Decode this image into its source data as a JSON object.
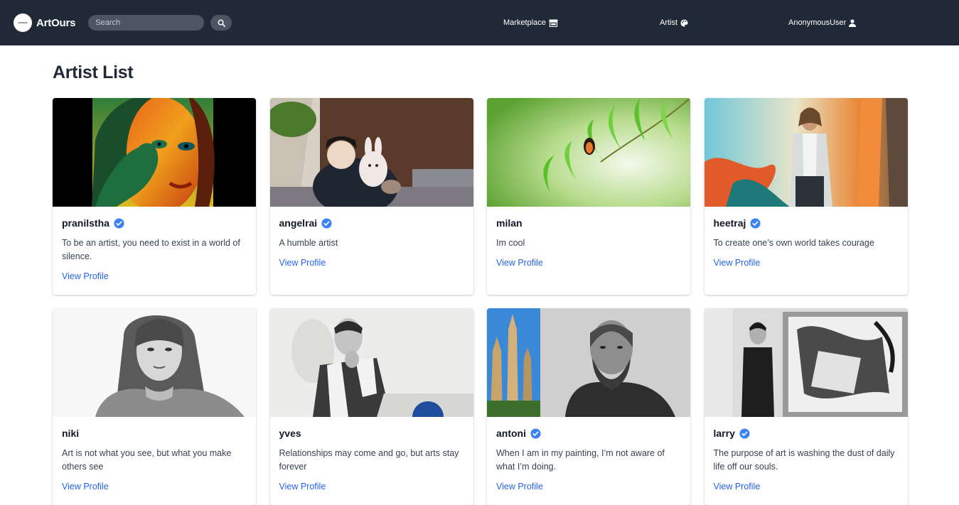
{
  "navbar": {
    "brand": "ArtOurs",
    "search_placeholder": "Search",
    "links": [
      {
        "label": "Marketplace",
        "icon": "store-icon"
      },
      {
        "label": "Artist",
        "icon": "palette-icon"
      },
      {
        "label": "AnonymousUser",
        "icon": "user-icon"
      }
    ]
  },
  "page": {
    "title": "Artist List"
  },
  "artists": [
    {
      "name": "pranilstha",
      "verified": true,
      "bio": "To be an artist, you need to exist in a world of silence.",
      "link": "View Profile"
    },
    {
      "name": "angelrai",
      "verified": true,
      "bio": "A humble artist",
      "link": "View Profile"
    },
    {
      "name": "milan",
      "verified": false,
      "bio": "Im cool",
      "link": "View Profile"
    },
    {
      "name": "heetraj",
      "verified": true,
      "bio": "To create one’s own world takes courage",
      "link": "View Profile"
    },
    {
      "name": "niki",
      "verified": false,
      "bio": "Art is not what you see, but what you make others see",
      "link": "View Profile"
    },
    {
      "name": "yves",
      "verified": false,
      "bio": "Relationships may come and go, but arts stay forever",
      "link": "View Profile"
    },
    {
      "name": "antoni",
      "verified": true,
      "bio": "When I am in my painting, I’m not aware of what I’m doing.",
      "link": "View Profile"
    },
    {
      "name": "larry",
      "verified": true,
      "bio": "The purpose of art is washing the dust of daily life off our souls.",
      "link": "View Profile"
    }
  ],
  "colors": {
    "navbar_bg": "#1f2937",
    "link": "#2563eb",
    "verified_badge": "#3b82f6"
  }
}
